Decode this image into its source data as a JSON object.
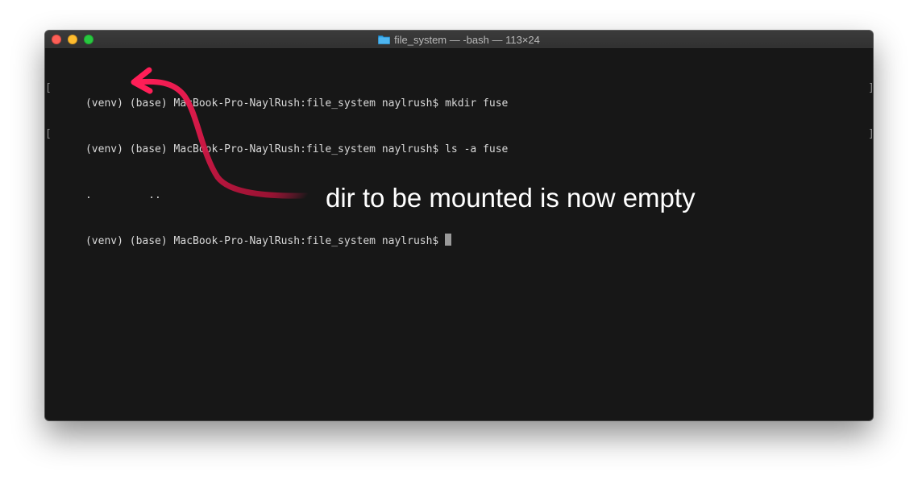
{
  "window": {
    "title": "file_system — -bash — 113×24",
    "icon": "folder-icon"
  },
  "terminal": {
    "lines": [
      "(venv) (base) MacBook-Pro-NaylRush:file_system naylrush$ mkdir fuse",
      "(venv) (base) MacBook-Pro-NaylRush:file_system naylrush$ ls -a fuse",
      ".         ..",
      "(venv) (base) MacBook-Pro-NaylRush:file_system naylrush$ "
    ],
    "bracket_left": "[",
    "bracket_right": "]"
  },
  "annotation": {
    "text": "dir to be mounted is now empty",
    "arrow_color": "#d8194a"
  },
  "colors": {
    "terminal_bg": "#171717",
    "terminal_fg": "#d8d8d8",
    "traffic_close": "#fd5f57",
    "traffic_min": "#febc2e",
    "traffic_max": "#28c840"
  }
}
